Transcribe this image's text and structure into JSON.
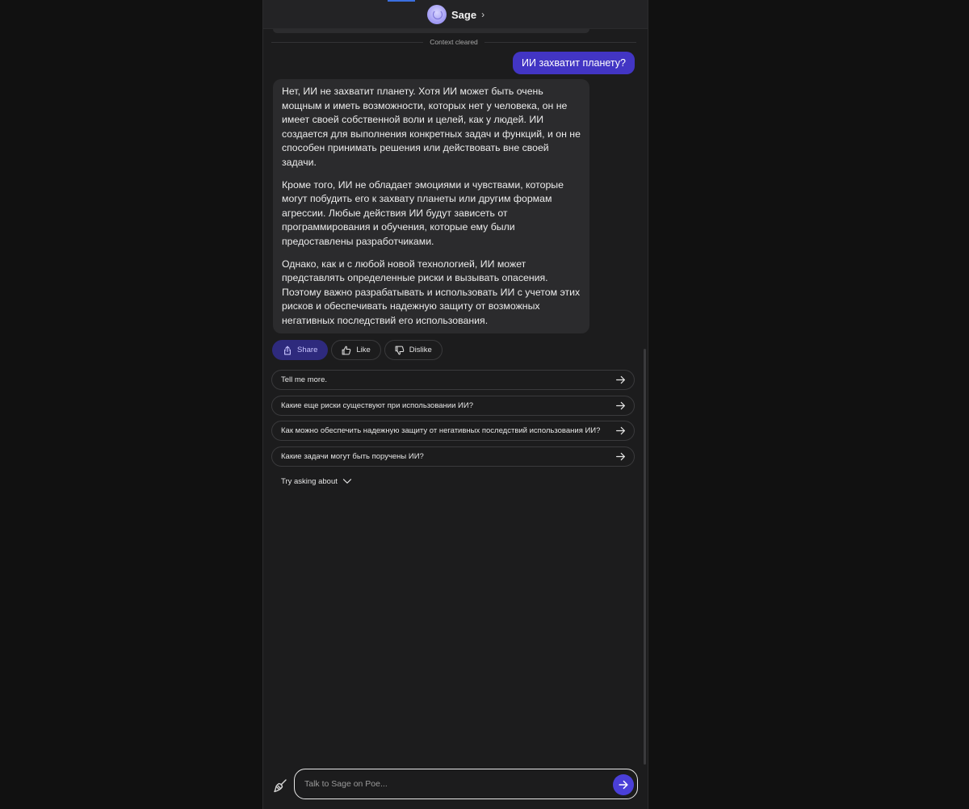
{
  "header": {
    "bot_name": "Sage",
    "chevron": "›",
    "avatar_icon": "sage-avatar-icon"
  },
  "chat": {
    "divider_text": "Context cleared",
    "user_message": "ИИ захватит планету?",
    "bot_paragraphs": [
      "Нет, ИИ не захватит планету. Хотя ИИ может быть очень мощным и иметь возможности, которых нет у человека, он не имеет своей собственной воли и целей, как у людей. ИИ создается для выполнения конкретных задач и функций, и он не способен принимать решения или действовать вне своей задачи.",
      "Кроме того, ИИ не обладает эмоциями и чувствами, которые могут побудить его к захвату планеты или другим формам агрессии. Любые действия ИИ будут зависеть от программирования и обучения, которые ему были предоставлены разработчиками.",
      "Однако, как и с любой новой технологией, ИИ может представлять определенные риски и вызывать опасения. Поэтому важно разрабатывать и использовать ИИ с учетом этих рисков и обеспечивать надежную защиту от возможных негативных последствий его использования."
    ]
  },
  "actions": {
    "share": "Share",
    "like": "Like",
    "dislike": "Dislike"
  },
  "suggestions": [
    "Tell me more.",
    "Какие еще риски существуют при использовании ИИ?",
    "Как можно обеспечить надежную защиту от негативных последствий использования ИИ?",
    "Какие задачи могут быть поручены ИИ?"
  ],
  "try_asking": "Try asking about",
  "composer": {
    "placeholder": "Talk to Sage on Poe..."
  },
  "colors": {
    "user_bubble": "#4235c4",
    "share_button": "#2e2a7d",
    "send_button": "#4a3fd8",
    "bot_bubble": "#2b2b2d"
  }
}
